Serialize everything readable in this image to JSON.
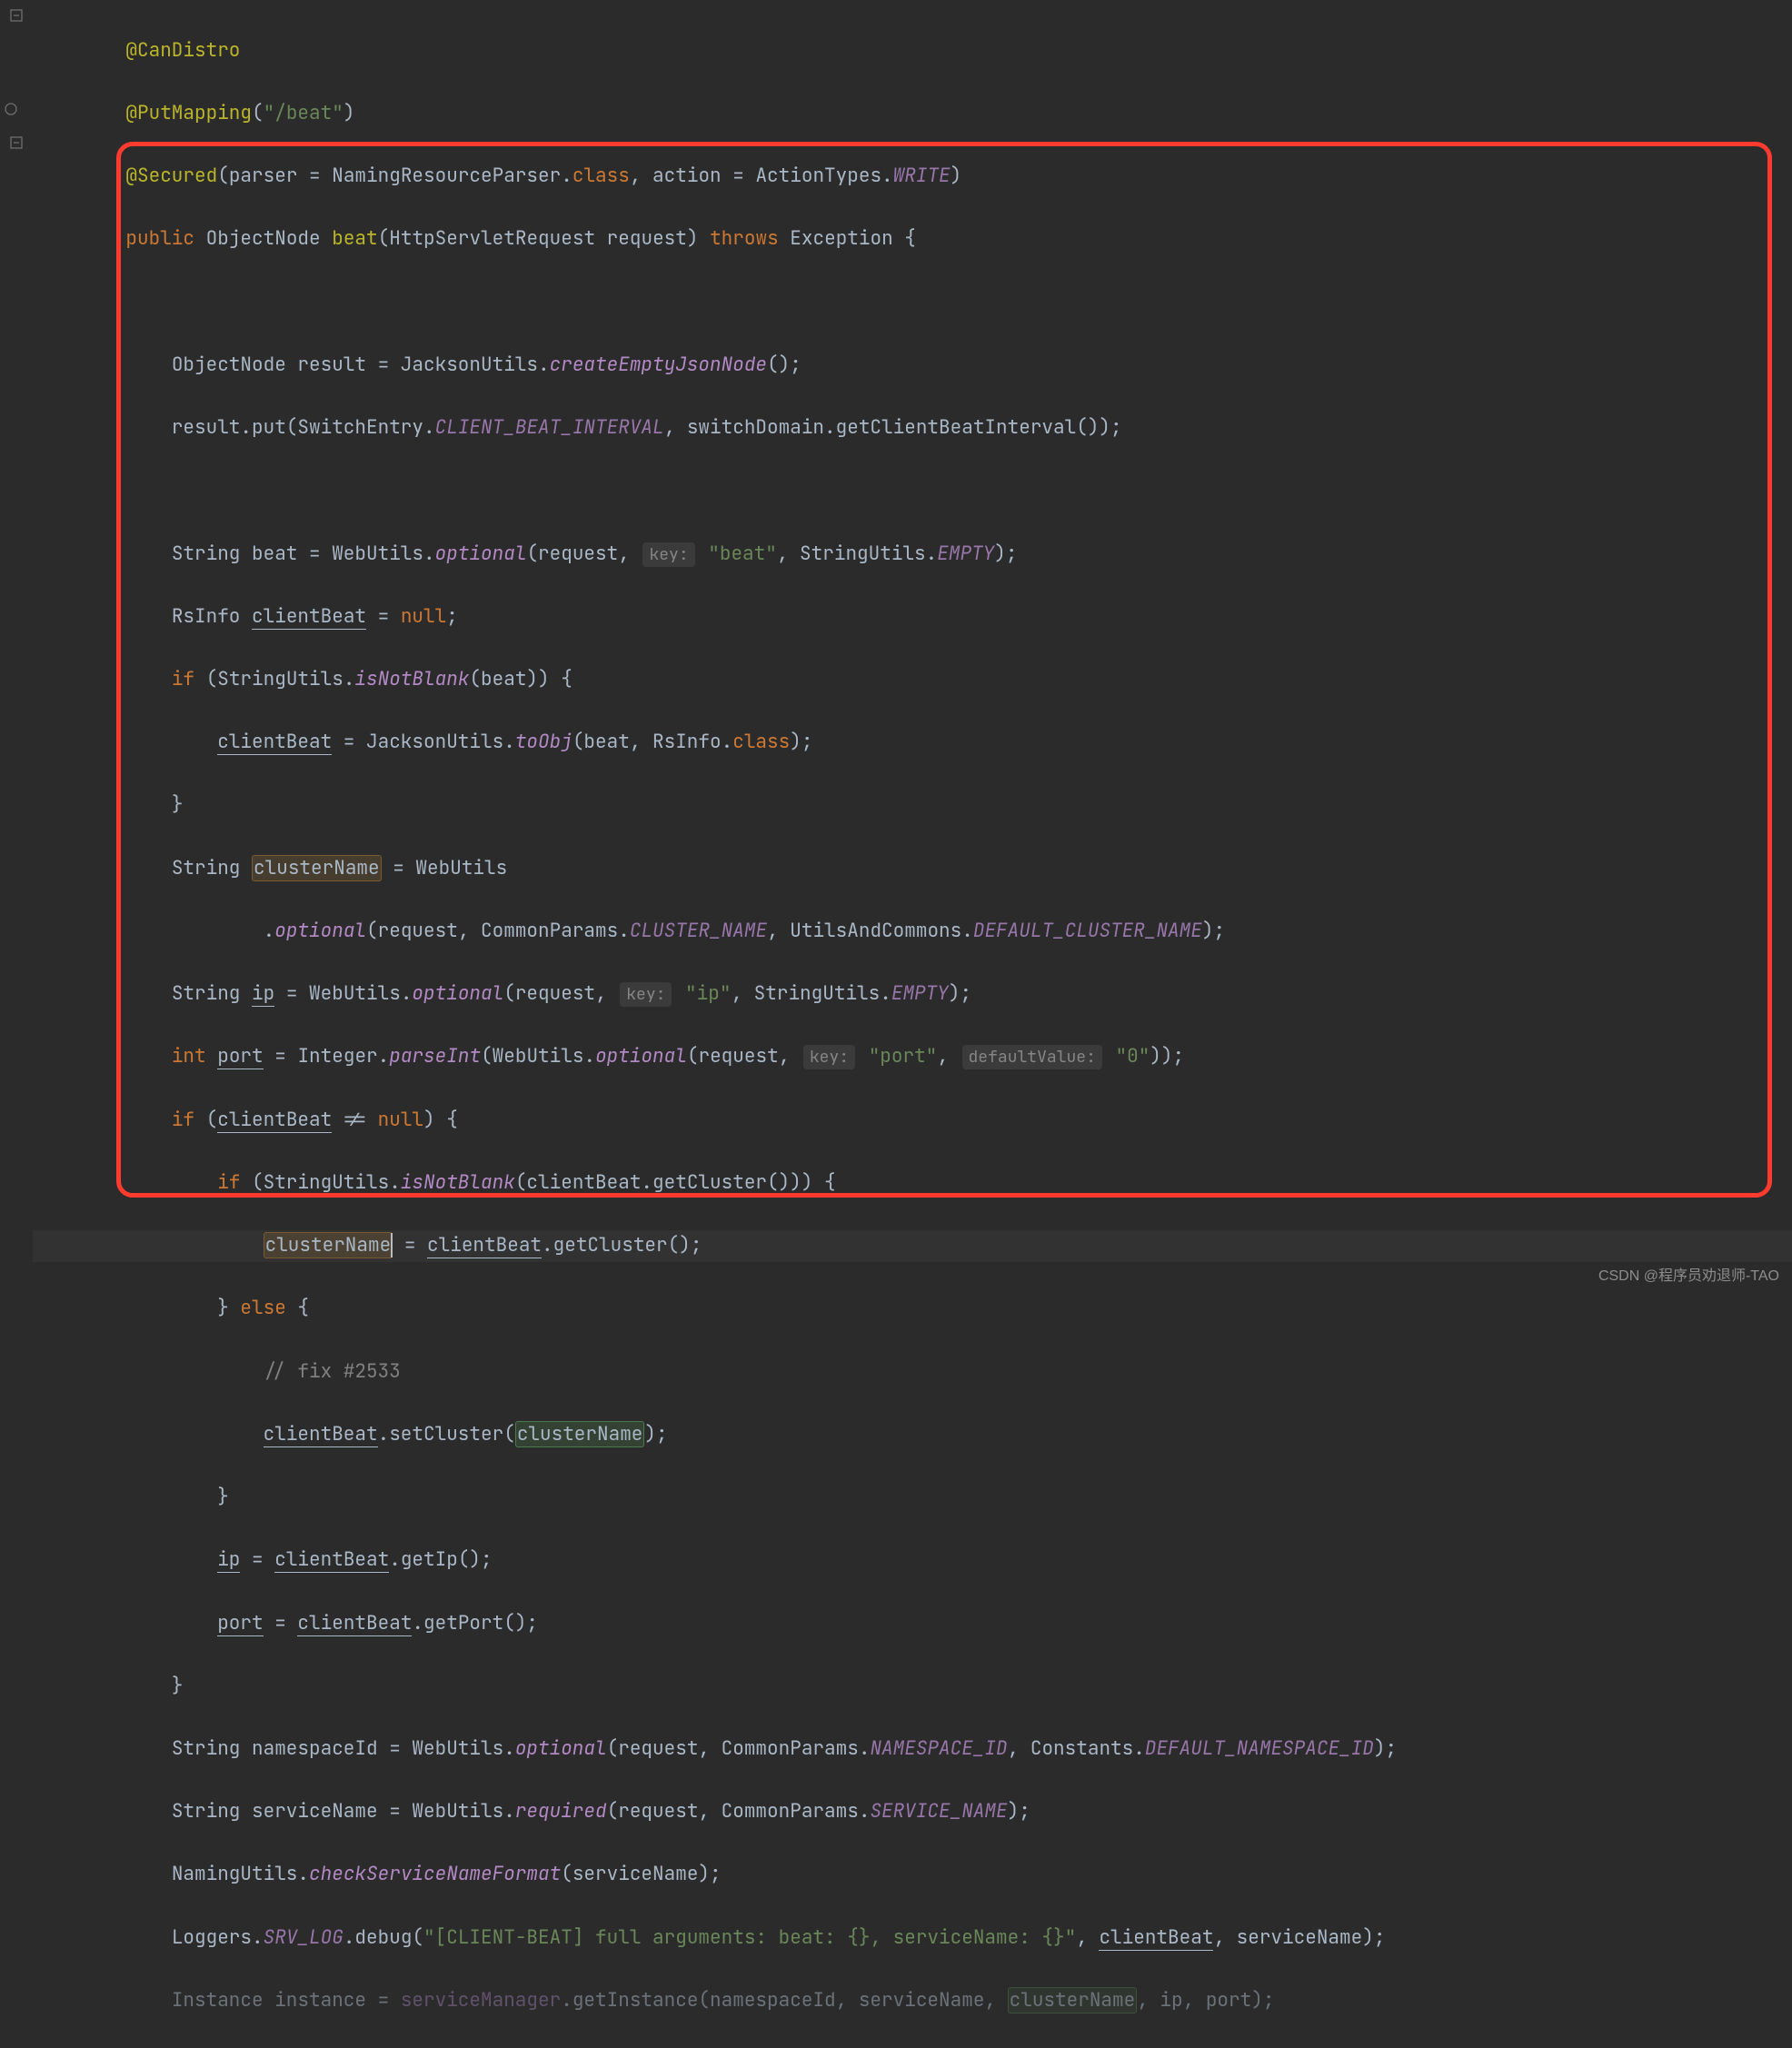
{
  "annotations": {
    "canDistro": "@CanDistro",
    "putMapping_pre": "@PutMapping",
    "putMapping_arg": "\"/beat\"",
    "secured_pre": "@Secured",
    "secured_parser": "parser = NamingResourceParser",
    "secured_class": "class",
    "secured_action": "action = ActionTypes",
    "secured_write": "WRITE"
  },
  "sig": {
    "public": "public",
    "retType": "ObjectNode",
    "name": "beat",
    "paramType": "HttpServletRequest",
    "paramName": "request",
    "throws": "throws",
    "exc": "Exception"
  },
  "b": {
    "l1a": "ObjectNode result = JacksonUtils.",
    "l1b": "createEmptyJsonNode",
    "l1c": "();",
    "l2a": "result.put(SwitchEntry.",
    "l2b": "CLIENT_BEAT_INTERVAL",
    "l2c": ", switchDomain.getClientBeatInterval());",
    "l3a": "String beat = WebUtils.",
    "l3b": "optional",
    "l3c": "(request, ",
    "l3hint": "key:",
    "l3str": "\"beat\"",
    "l3d": ", StringUtils.",
    "l3e": "EMPTY",
    "l3f": ");",
    "l4a": "RsInfo ",
    "l4b": "clientBeat",
    "l4c": " = ",
    "l4null": "null",
    "l4d": ";",
    "l5if": "if",
    "l5a": " (StringUtils.",
    "l5b": "isNotBlank",
    "l5c": "(beat)) {",
    "l6a": "clientBeat",
    "l6b": " = JacksonUtils.",
    "l6c": "toObj",
    "l6d": "(beat, RsInfo.",
    "l6e": "class",
    "l6f": ");",
    "l7": "}",
    "l8a": "String ",
    "l8b": "clusterName",
    "l8c": " = WebUtils",
    "l9a": ".",
    "l9b": "optional",
    "l9c": "(request, CommonParams.",
    "l9d": "CLUSTER_NAME",
    "l9e": ", UtilsAndCommons.",
    "l9f": "DEFAULT_CLUSTER_NAME",
    "l9g": ");",
    "l10a": "String ",
    "l10b": "ip",
    "l10c": " = WebUtils.",
    "l10d": "optional",
    "l10e": "(request, ",
    "l10hint": "key:",
    "l10str": "\"ip\"",
    "l10f": ", StringUtils.",
    "l10g": "EMPTY",
    "l10h": ");",
    "l11int": "int",
    "l11a": " ",
    "l11b": "port",
    "l11c": " = Integer.",
    "l11d": "parseInt",
    "l11e": "(WebUtils.",
    "l11f": "optional",
    "l11g": "(request, ",
    "l11hint1": "key:",
    "l11str1": "\"port\"",
    "l11h": ", ",
    "l11hint2": "defaultValue:",
    "l11str2": "\"0\"",
    "l11i": "));",
    "l12if": "if",
    "l12a": " (",
    "l12b": "clientBeat",
    "l12c": " != ",
    "l12null": "null",
    "l12d": ") {",
    "l13if": "if",
    "l13a": " (StringUtils.",
    "l13b": "isNotBlank",
    "l13c": "(",
    "l13d": "clientBeat",
    "l13e": ".getCluster())) {",
    "l14a": "clusterName",
    "l14b": " = ",
    "l14c": "clientBeat",
    "l14d": ".getCluster();",
    "l15else": "else",
    "l15a": "} ",
    "l15b": " {",
    "l16": "// fix #2533",
    "l17a": "clientBeat",
    "l17b": ".setCluster(",
    "l17c": "clusterName",
    "l17d": ");",
    "l18": "}",
    "l19a": "ip",
    "l19b": " = ",
    "l19c": "clientBeat",
    "l19d": ".getIp();",
    "l20a": "port",
    "l20b": " = ",
    "l20c": "clientBeat",
    "l20d": ".getPort();",
    "l21": "}",
    "l22a": "String namespaceId = WebUtils.",
    "l22b": "optional",
    "l22c": "(request, CommonParams.",
    "l22d": "NAMESPACE_ID",
    "l22e": ", Constants.",
    "l22f": "DEFAULT_NAMESPACE_ID",
    "l22g": ");",
    "l23a": "String serviceName = WebUtils.",
    "l23b": "required",
    "l23c": "(request, CommonParams.",
    "l23d": "SERVICE_NAME",
    "l23e": ");",
    "l24a": "NamingUtils.",
    "l24b": "checkServiceNameFormat",
    "l24c": "(serviceName);",
    "l25a": "Loggers.",
    "l25b": "SRV_LOG",
    "l25c": ".debug(",
    "l25str": "\"[CLIENT-BEAT] full arguments: beat: {}, serviceName: {}\"",
    "l25d": ", ",
    "l25e": "clientBeat",
    "l25f": ", serviceName);",
    "l26a": "Instance instance = ",
    "l26b": "serviceManager",
    "l26c": ".getInstance(namespaceId, serviceName, ",
    "l26d": "clusterName",
    "l26e": ", ip, port);"
  },
  "watermark": "CSDN @程序员劝退师-TAO"
}
